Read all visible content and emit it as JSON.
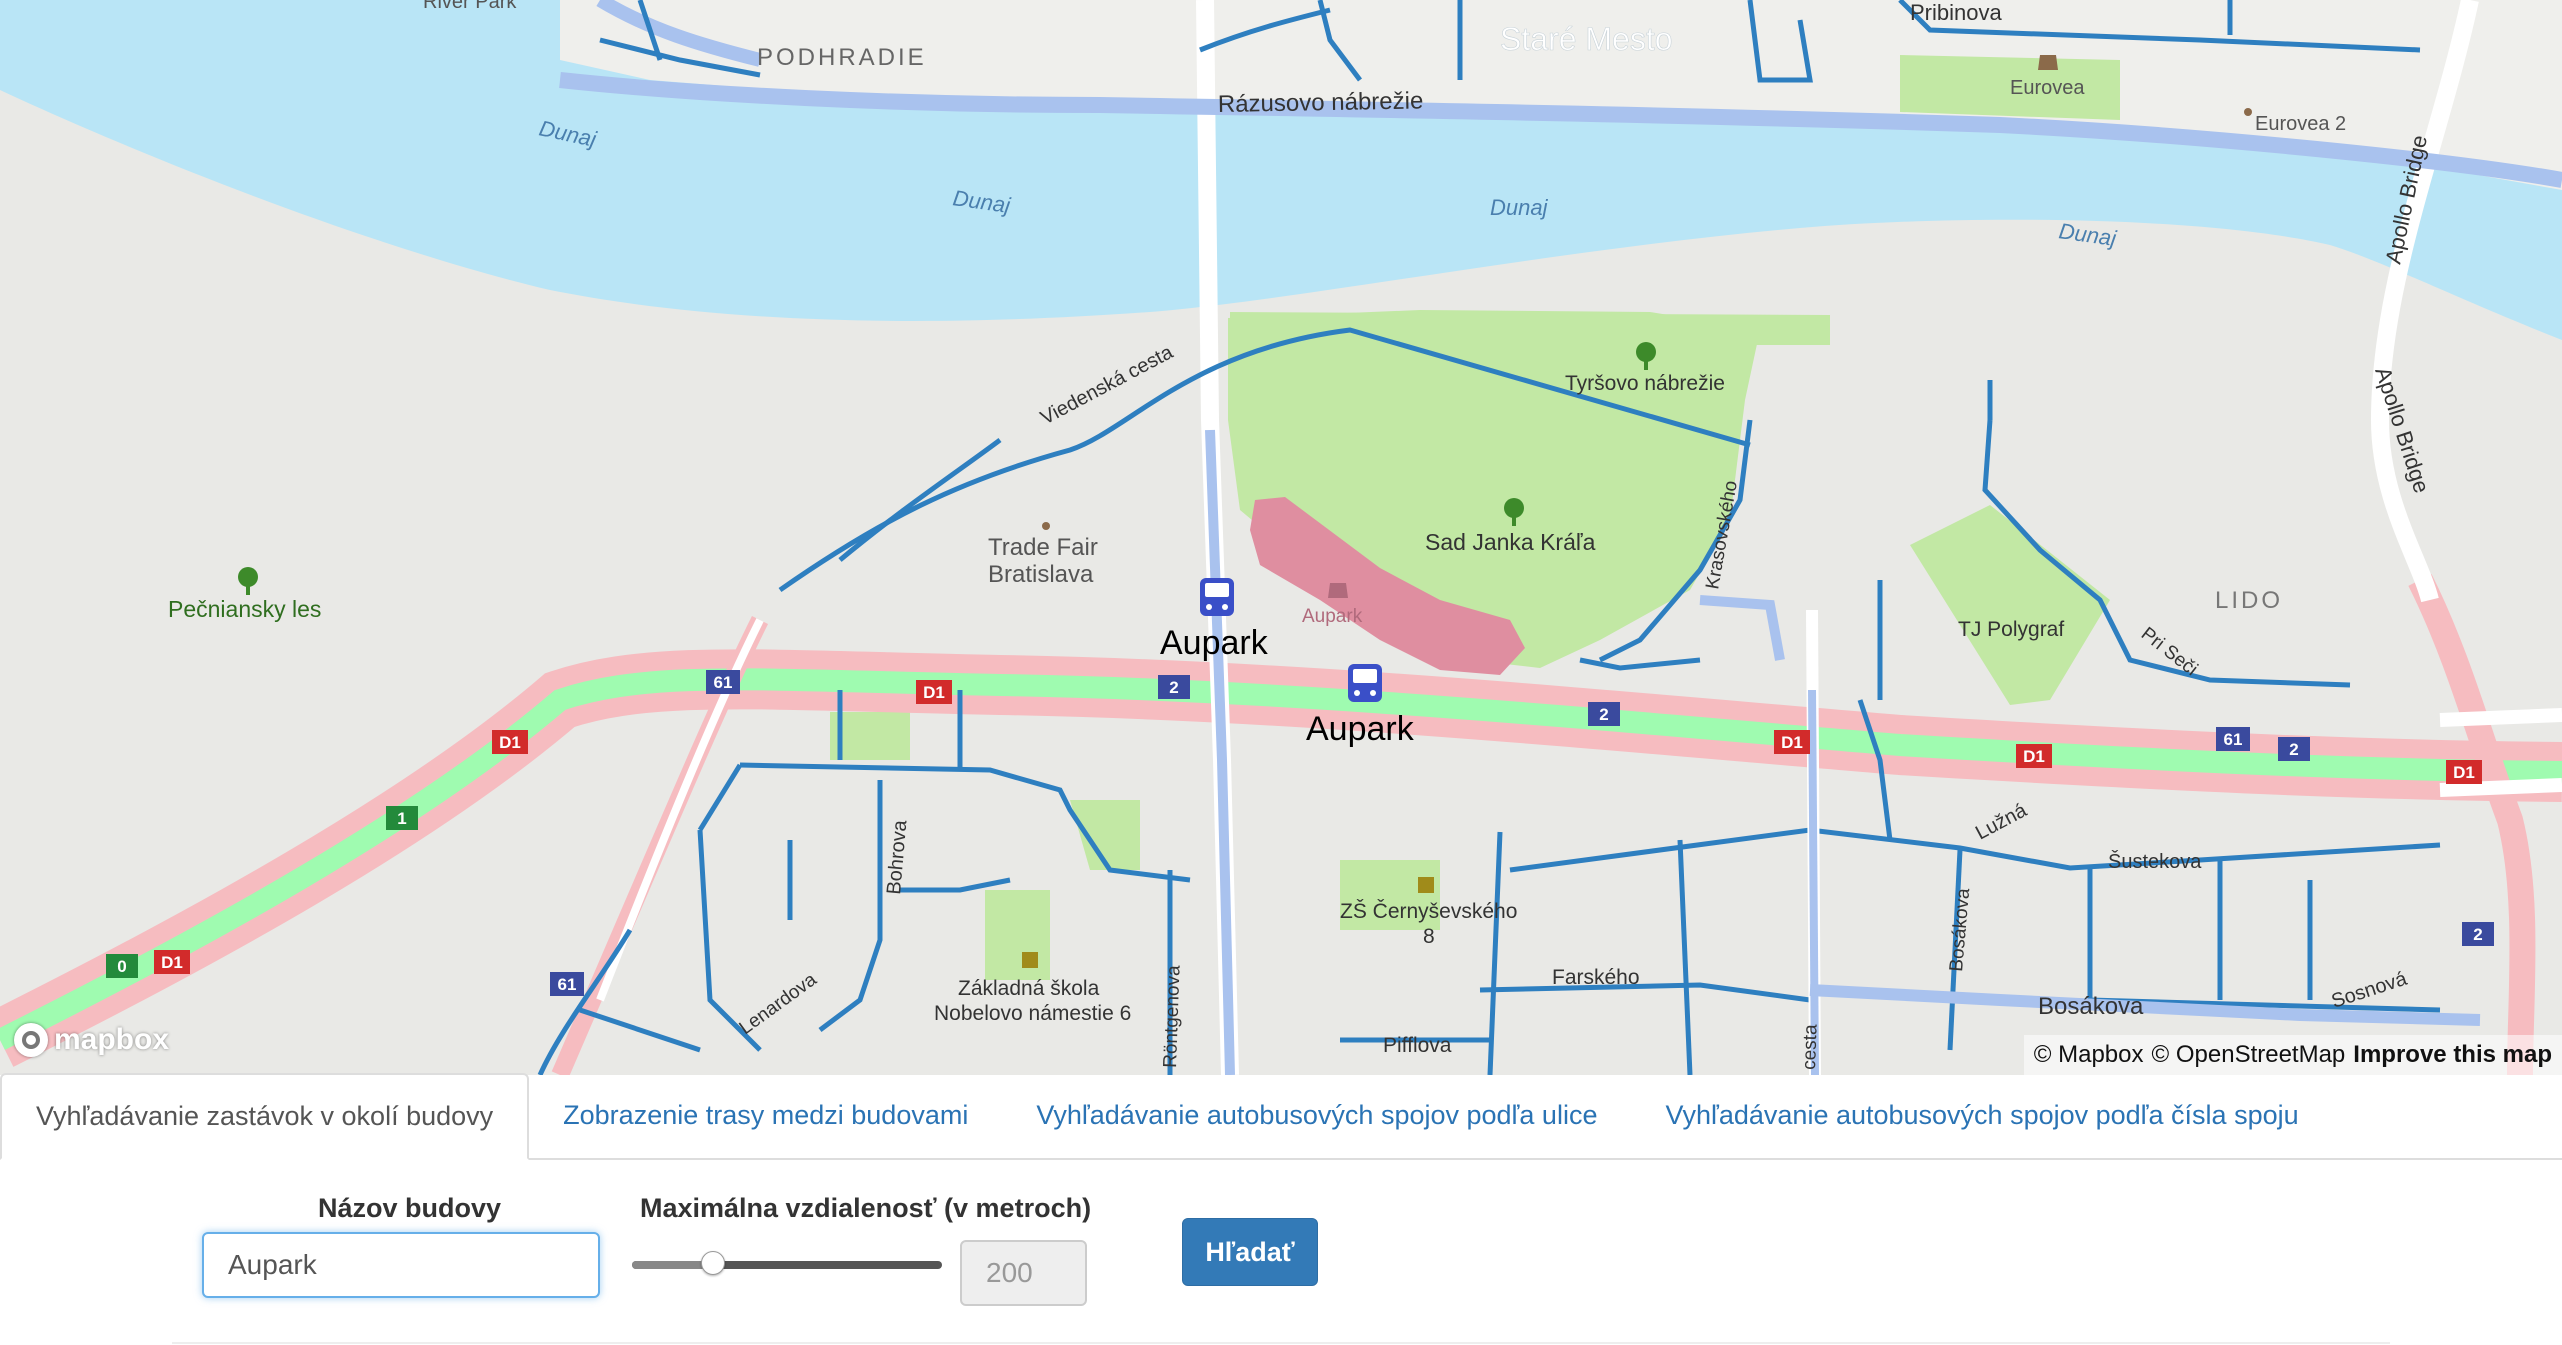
{
  "map": {
    "labels": {
      "river_park": "River Park",
      "podhradie": "PODHRADIE",
      "stare_mesto": "Staré Mesto",
      "pribinova": "Pribinova",
      "eurovea": "Eurovea",
      "eurovea2": "Eurovea 2",
      "razusovo": "Rázusovo nábrežie",
      "dunaj1": "Dunaj",
      "dunaj2": "Dunaj",
      "dunaj3": "Dunaj",
      "dunaj4": "Dunaj",
      "apollo1": "Apollo Bridge",
      "apollo2": "Apollo Bridge",
      "viedenska": "Viedenská cesta",
      "tyrsovo": "Tyršovo nábrežie",
      "sad": "Sad Janka Kráľa",
      "krasovskeho": "Krasovského",
      "trade1": "Trade Fair",
      "trade2": "Bratislava",
      "pecniansky": "Pečniansky les",
      "aupark_stop1": "Aupark",
      "aupark_stop2": "Aupark",
      "aupark_mall": "Aupark",
      "lido": "LIDO",
      "tj": "TJ Polygraf",
      "priseci": "Pri Seči",
      "luzna": "Lužná",
      "sustekova": "Šustekova",
      "bohrova": "Bohrova",
      "zs1": "ZŠ Černyševského",
      "zs2": "8",
      "farskeho": "Farského",
      "bosakova_v": "Bosákova",
      "bosakova_h": "Bosákova",
      "sosnova": "Sosnová",
      "zakladna1": "Základná škola",
      "zakladna2": "Nobelovo námestie 6",
      "rontgenova": "Röntgenova",
      "lenardova": "Lenardova",
      "pifflova": "Pifflova",
      "cesta": "cesta"
    },
    "shields": {
      "s61a": "61",
      "s61b": "61",
      "s61c": "61",
      "sd1a": "D1",
      "sd1b": "D1",
      "sd1c": "D1",
      "sd1d": "D1",
      "sd1e": "D1",
      "sd1f": "D1",
      "s2a": "2",
      "s2b": "2",
      "s2c": "2",
      "s2d": "2",
      "s1": "1",
      "s0": "0"
    },
    "logo": "mapbox",
    "attribution": {
      "mapbox": "© Mapbox",
      "osm": "© OpenStreetMap",
      "improve": "Improve this map"
    },
    "colors": {
      "water": "#b9e5f6",
      "park": "#c2e8a4",
      "highway": "#f6bcc0",
      "motorway_core": "#9ffbb0",
      "bus_route": "#2e7fc0",
      "aupark_building": "#df8ea0"
    }
  },
  "tabs": [
    {
      "label": "Vyhľadávanie zastávok v okolí budovy",
      "active": true
    },
    {
      "label": "Zobrazenie trasy medzi budovami",
      "active": false
    },
    {
      "label": "Vyhľadávanie autobusových spojov podľa ulice",
      "active": false
    },
    {
      "label": "Vyhľadávanie autobusových spojov podľa čísla spoju",
      "active": false
    }
  ],
  "form": {
    "building_label": "Názov budovy",
    "building_value": "Aupark",
    "distance_label": "Maximálna vzdialenosť (v metroch)",
    "distance_value": "200",
    "slider_fraction": 0.26,
    "search_button": "Hľadať"
  }
}
